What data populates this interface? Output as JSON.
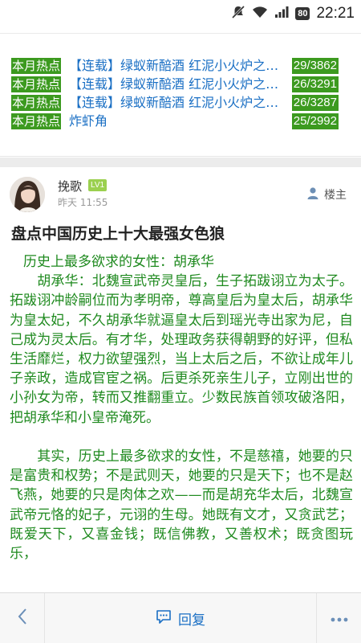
{
  "status_bar": {
    "time": "22:21",
    "battery": "80"
  },
  "hot_topics": [
    {
      "tag": "本月热点",
      "title": "【连载】绿蚁新醅酒 红泥小火炉之…",
      "count": "29/3862"
    },
    {
      "tag": "本月热点",
      "title": "【连载】绿蚁新醅酒 红泥小火炉之…",
      "count": "26/3291"
    },
    {
      "tag": "本月热点",
      "title": "【连载】绿蚁新醅酒 红泥小火炉之…",
      "count": "26/3287"
    },
    {
      "tag": "本月热点",
      "title": "炸虾角",
      "count": "25/2992"
    }
  ],
  "post": {
    "author": "挽歌",
    "level": "LV1",
    "time": "昨天 11:55",
    "op_label": "楼主",
    "title": "盘点中国历史上十大最强女色狼",
    "paragraphs": [
      "　历史上最多欲求的女性：胡承华",
      "　　胡承华：北魏宣武帝灵皇后，生子拓跋诩立为太子。拓跋诩冲龄嗣位而为孝明帝，尊高皇后为皇太后，胡承华为皇太妃，不久胡承华就逼皇太后到瑶光寺出家为尼，自己成为灵太后。有才华，处理政务获得朝野的好评，但私生活靡烂，权力欲望强烈，当上太后之后，不欲让成年儿子亲政，造成官宦之祸。后更杀死亲生儿子，立刚出世的小孙女为帝，转而又推翻重立。少数民族首领攻破洛阳，把胡承华和小皇帝淹死。",
      "",
      "　　其实，历史上最多欲求的女性，不是慈禧，她要的只是富贵和权势；不是武则天，她要的只是天下；也不是赵飞燕，她要的只是肉体之欢——而是胡充华太后，北魏宣武帝元恪的妃子，元诩的生母。她既有文才，又贪武艺；既爱天下，又喜金钱；既信佛教，又善权术；既贪图玩乐，"
    ]
  },
  "bottom_bar": {
    "reply_label": "回复"
  },
  "colors": {
    "accent_green": "#3c9a1f",
    "link_blue": "#1a6fc4",
    "body_green": "#1f8a1f"
  }
}
